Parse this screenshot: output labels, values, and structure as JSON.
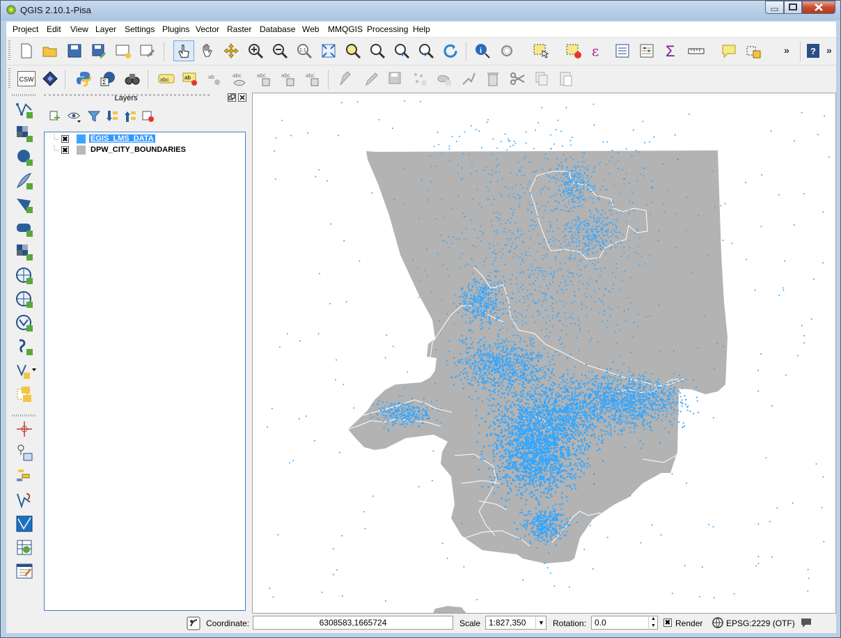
{
  "window": {
    "title": "QGIS 2.10.1-Pisa"
  },
  "menu": [
    "Project",
    "Edit",
    "View",
    "Layer",
    "Settings",
    "Plugins",
    "Vector",
    "Raster",
    "Database",
    "Web",
    "MMQGIS",
    "Processing",
    "Help"
  ],
  "toolbar2": {
    "csw_label": "CSW",
    "label_tool_text": "abc"
  },
  "layers_panel": {
    "title": "Layers",
    "layers": [
      {
        "name": "EGIS_LMS_DATA",
        "checked": "✖",
        "swatch": "#3aa6ff",
        "selected": true
      },
      {
        "name": "DPW_CITY_BOUNDARIES",
        "checked": "✖",
        "swatch": "#b8b8b8",
        "selected": false
      }
    ]
  },
  "map": {
    "polygon_fill": "#b3b3b3",
    "boundary_stroke": "#ffffff",
    "point_color": "#33a6ff"
  },
  "statusbar": {
    "coordinate_label": "Coordinate:",
    "coordinate_value": "6308583,1665724",
    "scale_label": "Scale",
    "scale_value": "1:827,350",
    "rotation_label": "Rotation:",
    "rotation_value": "0.0",
    "render_label": "Render",
    "render_checked": "✖",
    "crs_label": "EPSG:2229 (OTF)"
  }
}
